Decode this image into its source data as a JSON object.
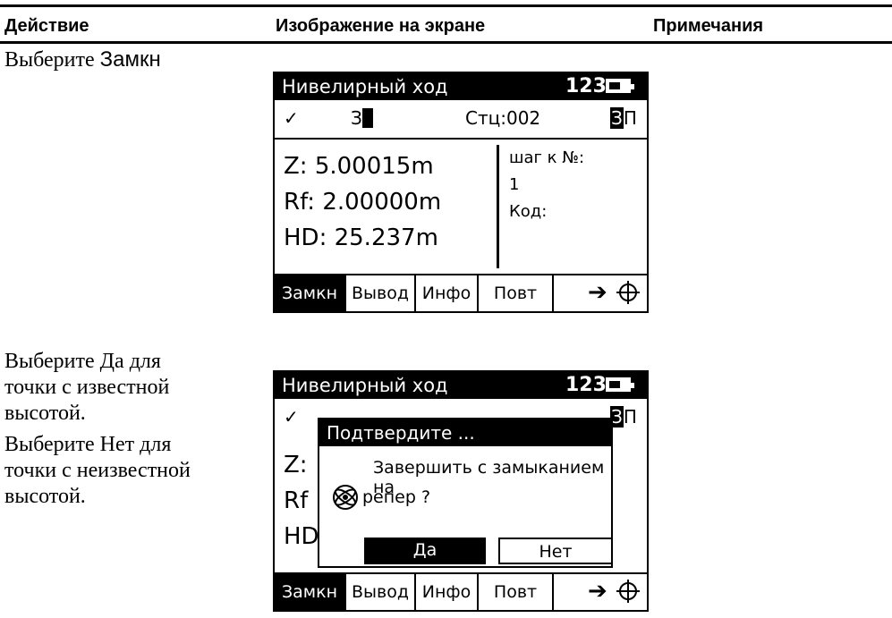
{
  "table": {
    "col_action": "Действие",
    "col_screen": "Изображение на экране",
    "col_notes": "Примечания"
  },
  "step1": {
    "instruction_prefix": "Выберите ",
    "instruction_key": "Замкн"
  },
  "step2": {
    "lines": [
      "Выберите Да для",
      "точки с известной",
      "высотой.",
      "Выберите Нет для",
      "точки с неизвестной",
      "высотой."
    ]
  },
  "screen": {
    "title": "Нивелирный ход",
    "mode": "123",
    "check": "✓",
    "z_label": "З",
    "station": "Стц:002",
    "zp_first": "З",
    "zp_second": "П",
    "values": [
      "Z:   5.00015m",
      "Rf:  2.00000m",
      "HD: 25.237m"
    ],
    "info": [
      "шаг к №:",
      "1",
      "Код:"
    ],
    "softkeys": [
      "Замкн",
      "Вывод",
      "Инфо",
      "Повт"
    ],
    "arrow": "➔"
  },
  "screen2": {
    "partial_values": [
      "Z:",
      "Rf",
      "HD"
    ]
  },
  "dialog": {
    "title": "Подтвердите ...",
    "message_line1": "Завершить с замыканием на",
    "message_line2": "репер ?",
    "yes": "Да",
    "no": "Нет"
  }
}
